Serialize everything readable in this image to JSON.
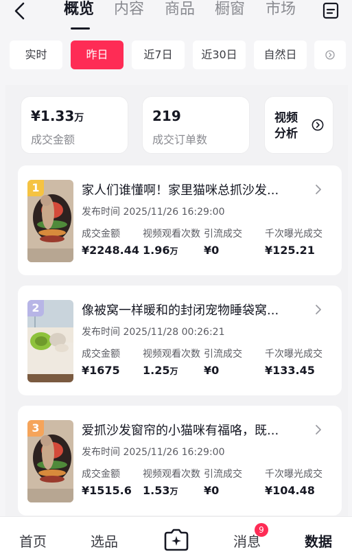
{
  "nav": {
    "tabs": [
      "概览",
      "内容",
      "商品",
      "橱窗",
      "市场"
    ]
  },
  "filters": [
    "实时",
    "昨日",
    "近7日",
    "近30日",
    "自然日"
  ],
  "filters_more_icon": "circle-chevron-right-icon",
  "stats": {
    "gmv": {
      "value": "¥1.33",
      "unit": "万",
      "label": "成交金额"
    },
    "orders": {
      "value": "219",
      "label": "成交订单数"
    },
    "video_analysis": {
      "label": "视频分析"
    }
  },
  "metric_labels": [
    "成交金额",
    "视频观看次数",
    "引流成交",
    "千次曝光成交"
  ],
  "publish_label": "发布时间",
  "videos": [
    {
      "rank": "1",
      "title": "家人们谁懂啊！家里猫咪总抓沙发...",
      "publish_time": "2025/11/26 16:29:00",
      "gmv": "¥2248.44",
      "views": "1.96",
      "views_unit": "万",
      "traffic_gmv": "¥0",
      "cpm_gmv": "¥125.21"
    },
    {
      "rank": "2",
      "title": "像被窝一样暖和的封闭宠物睡袋窝...",
      "publish_time": "2025/11/28 00:26:21",
      "gmv": "¥1675",
      "views": "1.25",
      "views_unit": "万",
      "traffic_gmv": "¥0",
      "cpm_gmv": "¥133.45"
    },
    {
      "rank": "3",
      "title": "爱抓沙发窗帘的小猫咪有福咯，既...",
      "publish_time": "2025/11/26 16:29:00",
      "gmv": "¥1515.6",
      "views": "1.53",
      "views_unit": "万",
      "traffic_gmv": "¥0",
      "cpm_gmv": "¥104.48"
    }
  ],
  "bottom_nav": {
    "home": "首页",
    "select": "选品",
    "messages": "消息",
    "messages_badge": "9",
    "data": "数据"
  },
  "colors": {
    "accent": "#fe2c55",
    "rank1": "#f5c342",
    "rank2": "#b7b5e6",
    "rank3": "#f5a45a"
  }
}
